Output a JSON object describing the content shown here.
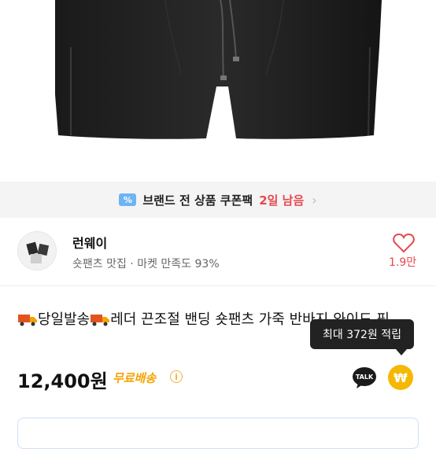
{
  "coupon": {
    "icon": "coupon-percent-icon",
    "text": "브랜드 전 상품 쿠폰팩",
    "highlight": "2일 남음",
    "accent": "#e5484d"
  },
  "shop": {
    "name": "런웨이",
    "subtitle": "숏팬츠 맛집 · 마켓 만족도 93%",
    "likes": "1.9만"
  },
  "product": {
    "title": "당일발송",
    "title_rest": "레더 끈조절 밴딩 숏팬츠 가죽 반바지 와이드 핏",
    "price": "12,400원",
    "shipping": "무료배송"
  },
  "tooltip": {
    "text": "최대 372원 적립"
  },
  "icons": {
    "talk_label": "TALK",
    "won_symbol": "₩"
  },
  "colors": {
    "shipping": "#f5a300",
    "point": "#f5b800"
  }
}
